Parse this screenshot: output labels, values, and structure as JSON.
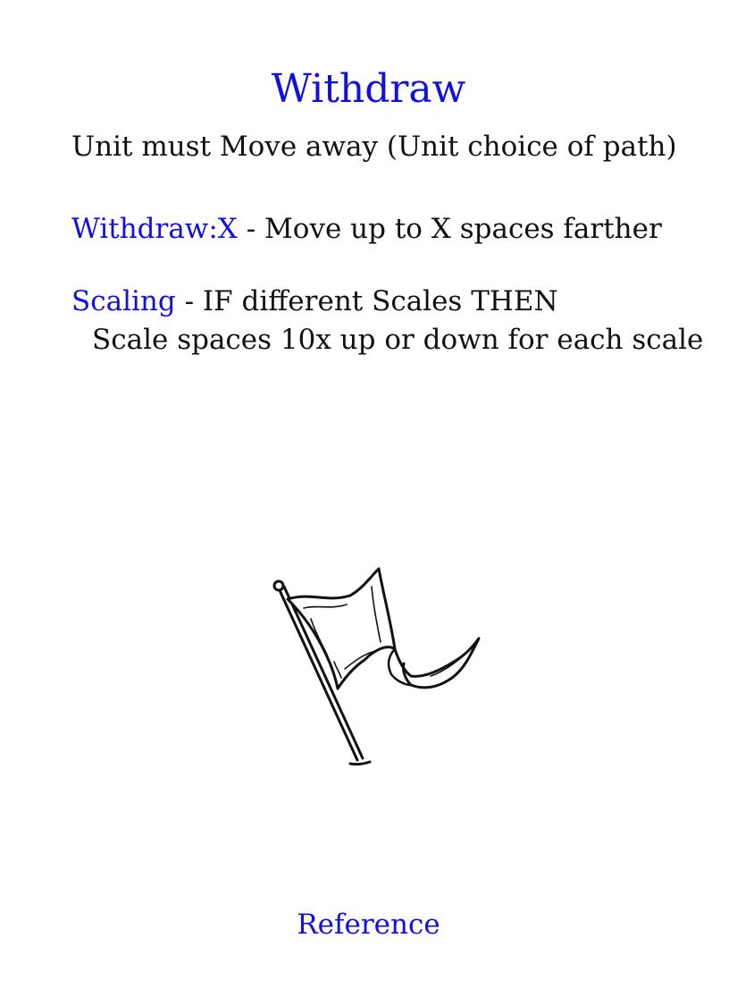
{
  "card": {
    "title": "Withdraw",
    "intro": "Unit must Move away (Unit choice of path)",
    "rules": [
      {
        "keyword": "Withdraw:X",
        "text": " - Move up to X spaces farther"
      },
      {
        "keyword": "Scaling",
        "text": " - IF different Scales THEN"
      }
    ],
    "scaling_detail": "Scale spaces 10x up or down for each scale",
    "footer": "Reference"
  },
  "icons": {
    "illustration": "flag-icon"
  },
  "colors": {
    "accent": "#1010e0",
    "text": "#111111",
    "background": "#ffffff"
  }
}
